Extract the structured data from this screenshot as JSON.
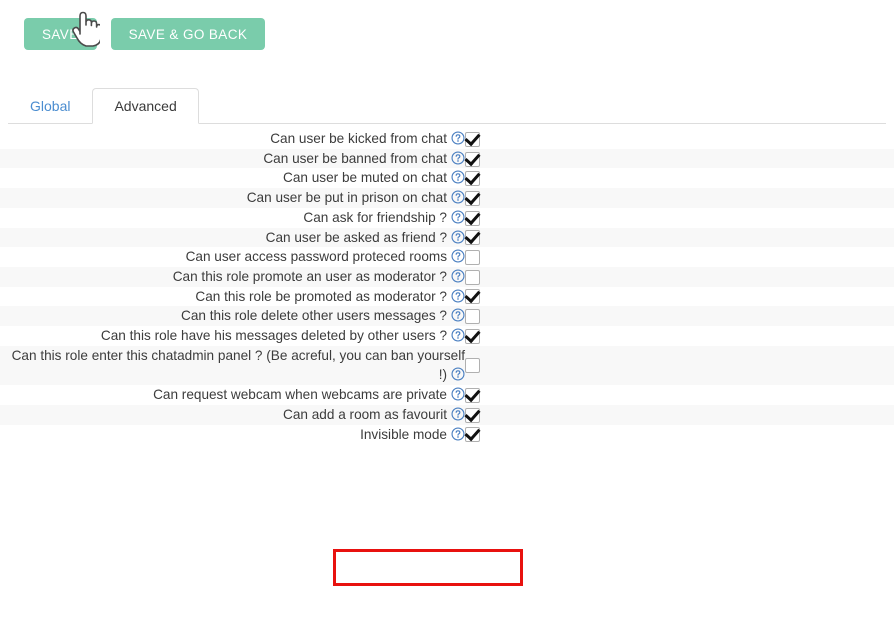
{
  "toolbar": {
    "save_label": "SAVE",
    "save_go_back_label": "SAVE & GO BACK",
    "button_color": "#7accab",
    "cursor_icon": "pointing-hand-cursor"
  },
  "tabs": [
    {
      "label": "Global",
      "active": false
    },
    {
      "label": "Advanced",
      "active": true
    }
  ],
  "help_icon_name": "help-circle-icon",
  "help_icon_color": "#4a7fc1",
  "highlight": {
    "color": "#e8110f",
    "target_row_label": "Invisible mode"
  },
  "permissions": [
    {
      "label": "Can user be kicked from chat",
      "checked": true,
      "help": true
    },
    {
      "label": "Can user be banned from chat",
      "checked": true,
      "help": true
    },
    {
      "label": "Can user be muted on chat",
      "checked": true,
      "help": true
    },
    {
      "label": "Can user be put in prison on chat",
      "checked": true,
      "help": true
    },
    {
      "label": "Can ask for friendship ?",
      "checked": true,
      "help": true
    },
    {
      "label": "Can user be asked as friend ?",
      "checked": true,
      "help": true
    },
    {
      "label": "Can user access password proteced rooms",
      "checked": false,
      "help": true
    },
    {
      "label": "Can this role promote an user as moderator ?",
      "checked": false,
      "help": true
    },
    {
      "label": "Can this role be promoted as moderator ?",
      "checked": true,
      "help": true
    },
    {
      "label": "Can this role delete other users messages ?",
      "checked": false,
      "help": true
    },
    {
      "label": "Can this role have his messages deleted by other users ?",
      "checked": true,
      "help": true
    },
    {
      "label": "Can this role enter this chatadmin panel ? (Be acreful, you can ban yourself !)",
      "checked": false,
      "help": true,
      "extra_help_inline": true
    },
    {
      "label": "Can request webcam when webcams are private",
      "checked": true,
      "help": true
    },
    {
      "label": "Can add a room as favourit",
      "checked": true,
      "help": true
    },
    {
      "label": "Invisible mode",
      "checked": true,
      "help": true,
      "highlighted": true
    }
  ]
}
